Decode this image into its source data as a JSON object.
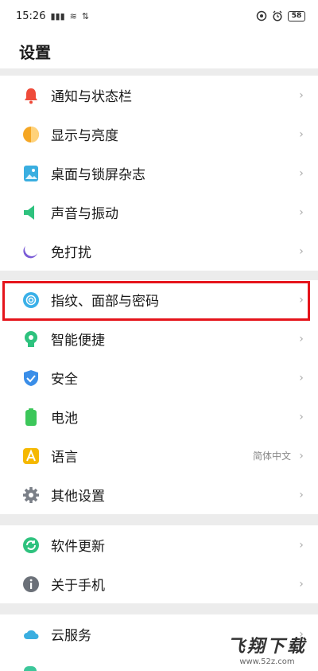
{
  "status_bar": {
    "time": "15:26",
    "signal": "▮▮▮",
    "wifi": "≋",
    "extra": "⇅",
    "battery": "58"
  },
  "header": {
    "title": "设置"
  },
  "group1": [
    {
      "label": "通知与状态栏"
    },
    {
      "label": "显示与亮度"
    },
    {
      "label": "桌面与锁屏杂志"
    },
    {
      "label": "声音与振动"
    },
    {
      "label": "免打扰"
    }
  ],
  "group2": [
    {
      "label": "指纹、面部与密码"
    },
    {
      "label": "智能便捷"
    },
    {
      "label": "安全"
    },
    {
      "label": "电池"
    },
    {
      "label": "语言",
      "value": "简体中文"
    },
    {
      "label": "其他设置"
    }
  ],
  "group3": [
    {
      "label": "软件更新"
    },
    {
      "label": "关于手机"
    }
  ],
  "group4": [
    {
      "label": "云服务"
    }
  ],
  "chevron": "›",
  "watermark": {
    "title": "飞翔下载",
    "url": "www.52z.com"
  },
  "colors": {
    "highlight": "#e5141b",
    "bell": "#ef4b3a",
    "display": "#f5a623",
    "wallpaper": "#3aaee0",
    "sound": "#2ec27e",
    "dnd": "#7b5cd6",
    "fingerprint": "#3ab0e8",
    "smart": "#2ec27e",
    "security": "#3a8ee8",
    "battery": "#3cc75a",
    "language": "#f5b800",
    "gear": "#7a7f87",
    "update": "#2ec27e",
    "about": "#6b7078",
    "cloud": "#3aaee0"
  }
}
